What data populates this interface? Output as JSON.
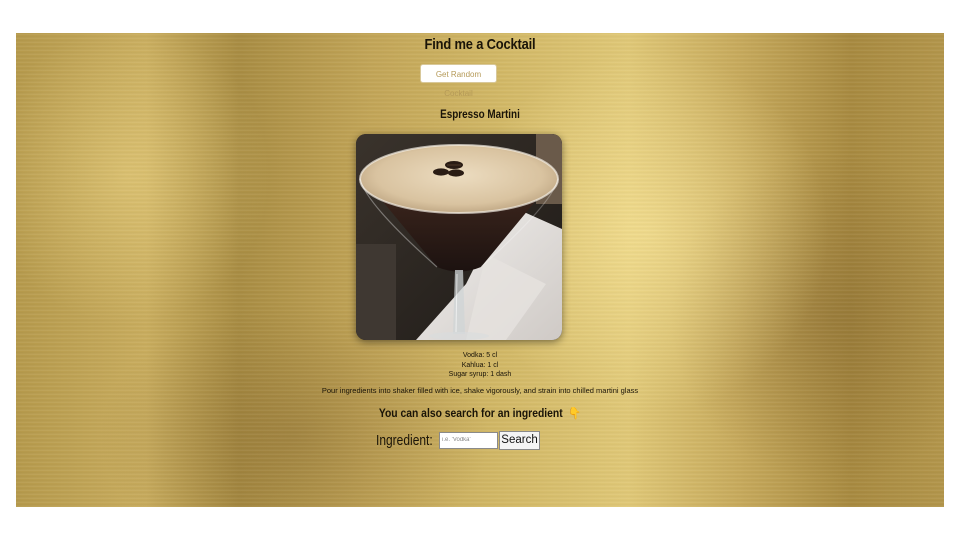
{
  "app": {
    "title": "Find me a Cocktail",
    "random_button_label": "Get Random Cocktail"
  },
  "drink": {
    "name": "Espresso Martini",
    "ingredients": [
      "Vodka: 5 cl",
      "Kahlua: 1 cl",
      "Sugar syrup: 1 dash"
    ],
    "instructions": "Pour ingredients into shaker filled with ice, shake vigorously, and strain into chilled martini glass"
  },
  "search": {
    "heading": "You can also search for an ingredient",
    "heading_icon": "pointing-down-hand-emoji",
    "label": "Ingredient:",
    "placeholder": "i.e. 'Vodka'",
    "value": "",
    "button_label": "Search"
  },
  "colors": {
    "gold_background": "#c2a557",
    "button_text": "#b59a58",
    "emoji_yellow": "#f2c21a"
  }
}
